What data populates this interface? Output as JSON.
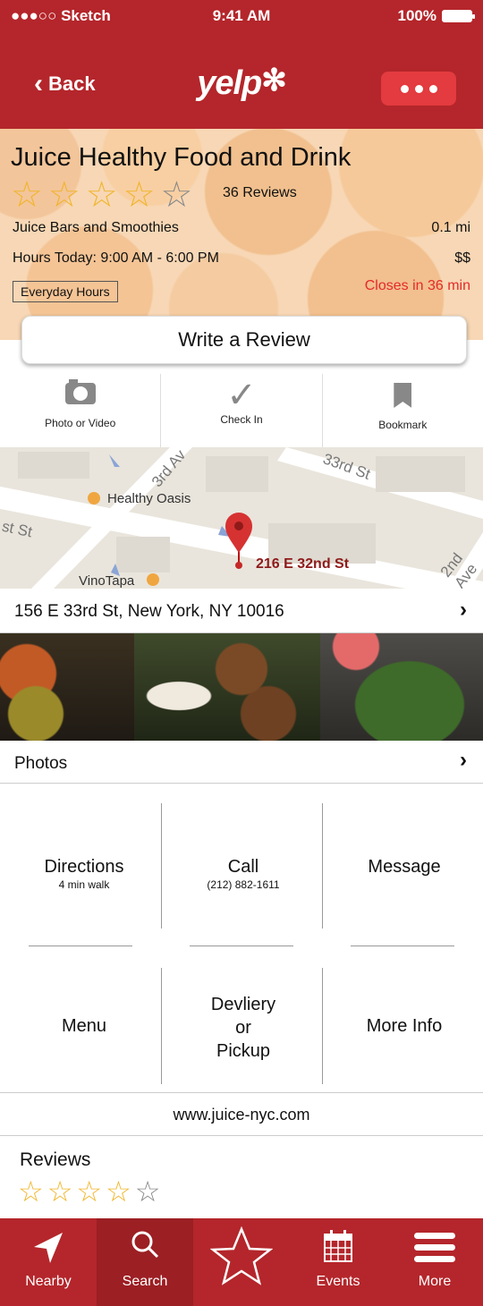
{
  "status_bar": {
    "carrier": "●●●○○ Sketch",
    "time": "9:41 AM",
    "battery": "100%"
  },
  "nav": {
    "back_label": "Back",
    "logo": "yelp"
  },
  "business": {
    "name": "Juice Healthy Food and Drink",
    "rating": 4,
    "rating_max": 5,
    "review_count": "36 Reviews",
    "category": "Juice Bars and Smoothies",
    "distance": "0.1 mi",
    "hours": "Hours Today: 9:00 AM - 6:00 PM",
    "price": "$$",
    "hours_tag": "Everyday Hours",
    "closes": "Closes in 36 min"
  },
  "write_review_label": "Write a Review",
  "actions": [
    {
      "label": "Photo or Video",
      "icon": "camera-icon"
    },
    {
      "label": "Check In",
      "icon": "checkmark-icon"
    },
    {
      "label": "Bookmark",
      "icon": "bookmark-icon"
    }
  ],
  "map": {
    "poi_1": "Healthy Oasis",
    "poi_2": "VinoTapa",
    "pin_label": "216 E 32nd St",
    "street_1": "3rd Av",
    "street_2": "33rd St",
    "street_3": "st St",
    "street_4": "2nd Ave"
  },
  "address": "156 E 33rd St, New York, NY 10016",
  "photos_label": "Photos",
  "grid": {
    "directions": "Directions",
    "directions_sub": "4 min walk",
    "call": "Call",
    "call_sub": "(212) 882-1611",
    "message": "Message",
    "menu": "Menu",
    "delivery_1": "Devliery",
    "delivery_2": "or",
    "delivery_3": "Pickup",
    "more_info": "More Info"
  },
  "website": "www.juice-nyc.com",
  "reviews_label": "Reviews",
  "reviews_rating": 4,
  "tabs": [
    {
      "label": "Nearby",
      "icon": "location-arrow-icon"
    },
    {
      "label": "Search",
      "icon": "search-icon"
    },
    {
      "label": "",
      "icon": "star-icon"
    },
    {
      "label": "Events",
      "icon": "calendar-icon"
    },
    {
      "label": "More",
      "icon": "hamburger-menu-icon"
    }
  ],
  "colors": {
    "brand_red": "#b4262b",
    "active_tab": "#9c1f24",
    "star": "#f0b52b",
    "closes_red": "#e32b2b"
  }
}
